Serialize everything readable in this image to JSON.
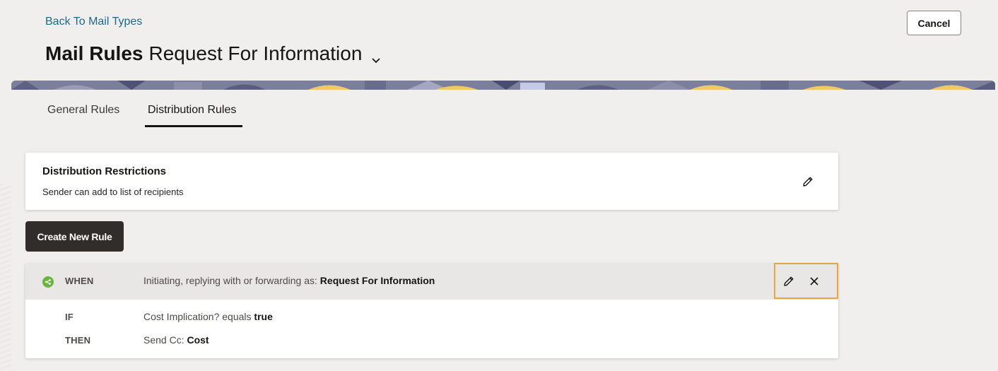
{
  "header": {
    "back_link": "Back To Mail Types",
    "title_bold": "Mail Rules",
    "title_rest": "Request For Information",
    "cancel_label": "Cancel"
  },
  "tabs": [
    {
      "label": "General Rules",
      "active": false
    },
    {
      "label": "Distribution Rules",
      "active": true
    }
  ],
  "distribution_restrictions": {
    "title": "Distribution Restrictions",
    "subtitle": "Sender can add to list of recipients"
  },
  "create_rule_label": "Create New Rule",
  "rule": {
    "status_color": "#6cb33f",
    "when_keyword": "WHEN",
    "when_text": "Initiating, replying with or forwarding as:",
    "when_value": "Request For Information",
    "if_keyword": "IF",
    "if_text": "Cost Implication? equals",
    "if_value": "true",
    "then_keyword": "THEN",
    "then_text": "Send Cc:",
    "then_value": "Cost"
  },
  "icons": {
    "dropdown": "chevron-down-icon",
    "edit": "pencil-icon",
    "remove": "close-icon",
    "status": "share-icon"
  },
  "colors": {
    "link": "#1b6a8a",
    "primary_button": "#312d2a",
    "focus_outline": "#e6a73e"
  }
}
